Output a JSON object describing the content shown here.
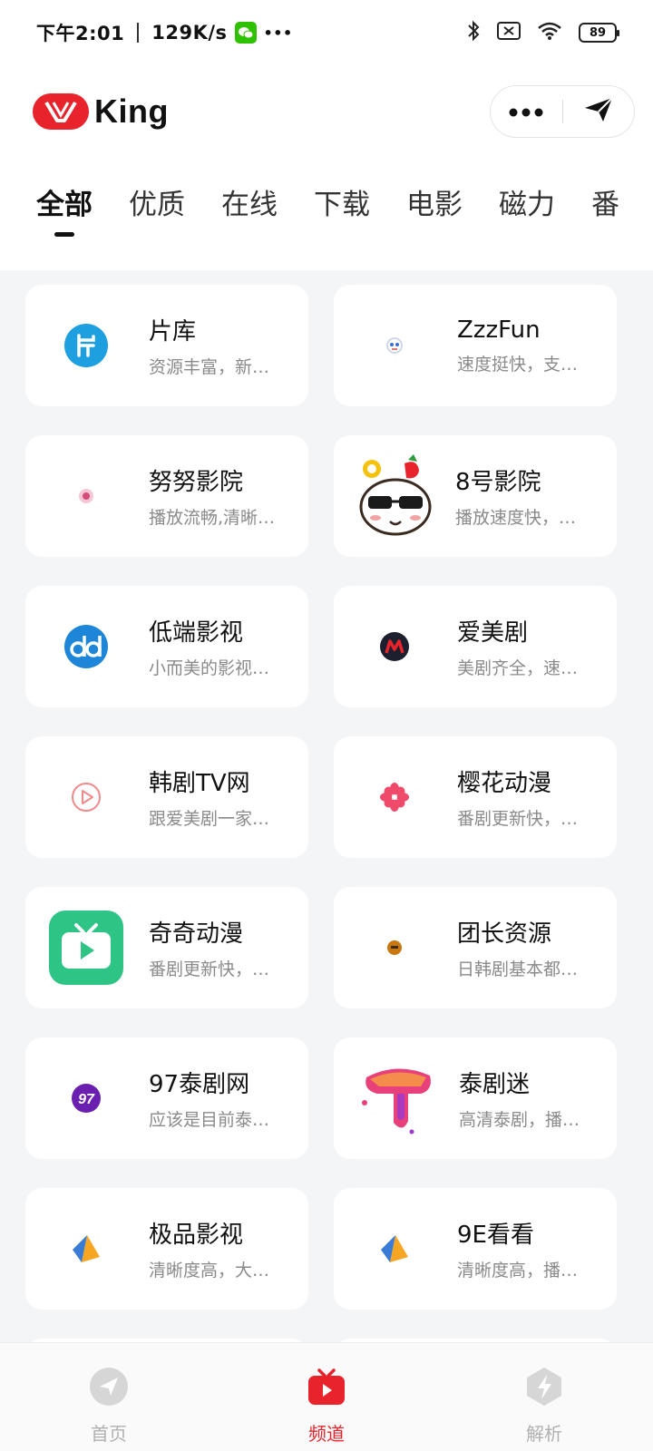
{
  "status_bar": {
    "time": "下午2:01",
    "speed": "129K/s",
    "more": "•••",
    "battery": "89"
  },
  "header": {
    "app_name": "King"
  },
  "tabs": [
    {
      "label": "全部",
      "active": true
    },
    {
      "label": "优质"
    },
    {
      "label": "在线"
    },
    {
      "label": "下载"
    },
    {
      "label": "电影"
    },
    {
      "label": "磁力"
    },
    {
      "label": "番"
    }
  ],
  "channels": [
    {
      "name": "片库",
      "desc": "资源丰富，新…",
      "icon": "pianku-icon"
    },
    {
      "name": "ZzzFun",
      "desc": "速度挺快，支…",
      "icon": "zzzfun-icon"
    },
    {
      "name": "努努影院",
      "desc": "播放流畅,清晰…",
      "icon": "nunu-icon"
    },
    {
      "name": "8号影院",
      "desc": "播放速度快，…",
      "icon": "cartoon-mascot-icon"
    },
    {
      "name": "低端影视",
      "desc": "小而美的影视…",
      "icon": "dd-icon"
    },
    {
      "name": "爱美剧",
      "desc": "美剧齐全，速…",
      "icon": "aimeiju-icon"
    },
    {
      "name": "韩剧TV网",
      "desc": "跟爱美剧一家…",
      "icon": "play-circle-icon"
    },
    {
      "name": "樱花动漫",
      "desc": "番剧更新快，…",
      "icon": "sakura-icon"
    },
    {
      "name": "奇奇动漫",
      "desc": "番剧更新快，…",
      "icon": "tv-play-icon"
    },
    {
      "name": "团长资源",
      "desc": "日韩剧基本都…",
      "icon": "tuanzhang-icon"
    },
    {
      "name": "97泰剧网",
      "desc": "应该是目前泰…",
      "icon": "ninety-seven-icon"
    },
    {
      "name": "泰剧迷",
      "desc": "高清泰剧，播…",
      "icon": "taijumi-icon"
    },
    {
      "name": "极品影视",
      "desc": "清晰度高，大…",
      "icon": "kite-icon"
    },
    {
      "name": "9E看看",
      "desc": "清晰度高，播…",
      "icon": "kite-icon"
    }
  ],
  "bottom_nav": [
    {
      "label": "首页",
      "icon": "compass-icon",
      "active": false
    },
    {
      "label": "频道",
      "icon": "tv-icon",
      "active": true
    },
    {
      "label": "解析",
      "icon": "bolt-shield-icon",
      "active": false
    }
  ],
  "colors": {
    "accent": "#e8232b",
    "background": "#f4f5f7",
    "card": "#ffffff",
    "muted_text": "#8a8a8a"
  }
}
